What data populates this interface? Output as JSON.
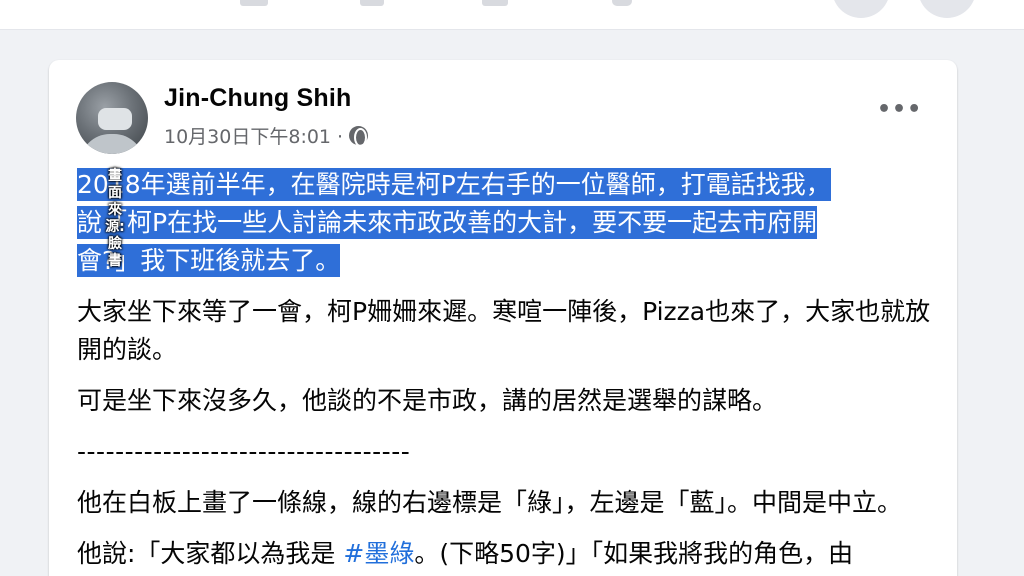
{
  "post": {
    "author": "Jin-Chung Shih",
    "timestamp": "10月30日下午8:01 · ",
    "privacy_icon": "globe-icon",
    "more_label": "•••",
    "highlighted_lines": [
      "2018年選前半年，在醫院時是柯P左右手的一位醫師，打電話找我，",
      "說「柯P在找一些人討論未來市政改善的大計，要不要一起去市府開",
      "會?」我下班後就去了。"
    ],
    "para2": "大家坐下來等了一會，柯P姍姍來遲。寒喧一陣後，Pizza也來了，大家也就放開的談。",
    "para3": "可是坐下來沒多久，他談的不是市政，講的居然是選舉的謀略。",
    "divider": "-----------------------------------",
    "para4": "他在白板上畫了一條線，線的右邊標是「綠」，左邊是「藍」。中間是中立。",
    "para5_before": "他說:「大家都以為我是 ",
    "para5_hashtag": "#墨綠",
    "para5_after": "。(下略50字)」「如果我將我的角色，由"
  },
  "watermark": {
    "source_label": "畫面來源:臉書"
  },
  "colors": {
    "highlight": "#2f6fd8",
    "hashtag": "#216fdb",
    "meta_text": "#65676b",
    "page_bg": "#f0f2f5"
  }
}
